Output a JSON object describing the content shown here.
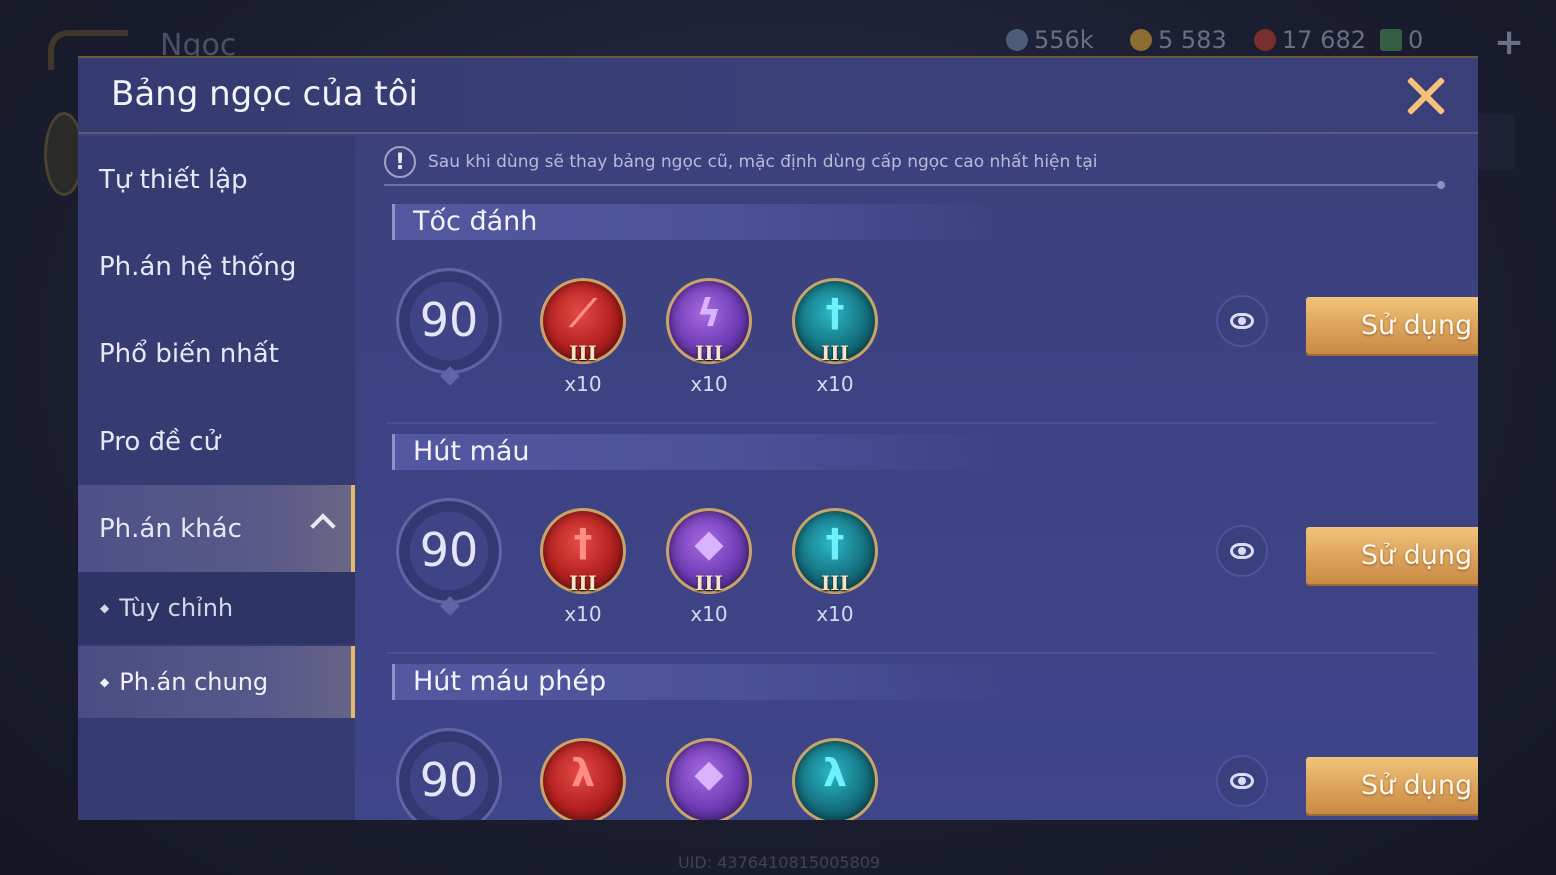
{
  "background": {
    "title": "Ngọc",
    "currencies": [
      {
        "icon": "gem-currency-icon",
        "value": "556k",
        "color": "#5d6b8a"
      },
      {
        "icon": "gold-coin-icon",
        "value": "5 583",
        "color": "#a8853a"
      },
      {
        "icon": "red-voucher-icon",
        "value": "17 682",
        "color": "#9a3b3b"
      },
      {
        "icon": "card-icon",
        "value": "0",
        "color": "#3f8a5a"
      }
    ],
    "plus": "+",
    "uid": "UID: 4376410815005809"
  },
  "modal": {
    "title": "Bảng ngọc của tôi",
    "notice": "Sau khi dùng sẽ thay bảng ngọc cũ, mặc định dùng cấp ngọc cao nhất hiện tại",
    "notice_icon": "!"
  },
  "sidebar": {
    "items": [
      {
        "label": "Tự thiết lập"
      },
      {
        "label": "Ph.án hệ thống"
      },
      {
        "label": "Phổ biến nhất"
      },
      {
        "label": "Pro đề cử"
      },
      {
        "label": "Ph.án khác"
      }
    ],
    "sub_items": [
      {
        "label": "Tùy chỉnh"
      },
      {
        "label": "Ph.án chung"
      }
    ],
    "active_item": "Ph.án khác",
    "active_sub_item": "Ph.án chung"
  },
  "sections": [
    {
      "title": "Tốc đánh",
      "level": "90",
      "gems": [
        {
          "color": "red",
          "glyph": "⟋",
          "tier": "III",
          "count": "x10"
        },
        {
          "color": "purple",
          "glyph": "ϟ",
          "tier": "III",
          "count": "x10"
        },
        {
          "color": "teal",
          "glyph": "†",
          "tier": "III",
          "count": "x10"
        }
      ],
      "use_label": "Sử dụng"
    },
    {
      "title": "Hút máu",
      "level": "90",
      "gems": [
        {
          "color": "red",
          "glyph": "†",
          "tier": "III",
          "count": "x10"
        },
        {
          "color": "purple",
          "glyph": "◆",
          "tier": "III",
          "count": "x10"
        },
        {
          "color": "teal",
          "glyph": "†",
          "tier": "III",
          "count": "x10"
        }
      ],
      "use_label": "Sử dụng"
    },
    {
      "title": "Hút máu phép",
      "level": "90",
      "gems": [
        {
          "color": "red",
          "glyph": "λ",
          "tier": "",
          "count": ""
        },
        {
          "color": "purple",
          "glyph": "◆",
          "tier": "",
          "count": ""
        },
        {
          "color": "teal",
          "glyph": "λ",
          "tier": "",
          "count": ""
        }
      ],
      "use_label": "Sử dụng"
    }
  ],
  "colors": {
    "accent_gold": "#e4b86a",
    "button_gold": "#dba25a",
    "panel": "#3d4283"
  }
}
